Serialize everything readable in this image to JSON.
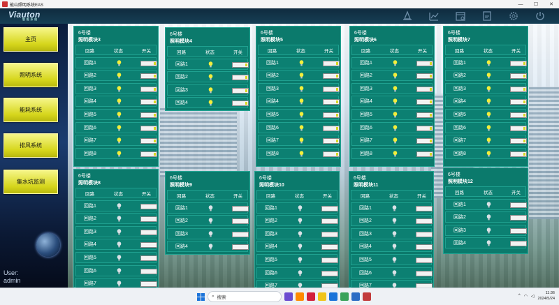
{
  "window": {
    "title": "能山照明系统EAS"
  },
  "logo": {
    "text": "Viauton",
    "sub": "智 能 系 统"
  },
  "toolbar": {
    "icons": [
      "bell-icon",
      "chart-icon",
      "calendar-icon",
      "document-icon",
      "settings-icon",
      "power-icon"
    ]
  },
  "sidebar": {
    "items": [
      {
        "label": "主页"
      },
      {
        "label": "照明系统"
      },
      {
        "label": "能耗系统"
      },
      {
        "label": "排风系统"
      },
      {
        "label": "集水坑监测"
      }
    ],
    "user_label": "User:",
    "user_name": "admin"
  },
  "table_headers": {
    "circuit": "回路",
    "status": "状态",
    "switch": "开关"
  },
  "panels": [
    {
      "building": "6号楼",
      "name": "照明模块3",
      "circuits": [
        {
          "label": "回路1",
          "lit": true
        },
        {
          "label": "回路2",
          "lit": true
        },
        {
          "label": "回路3",
          "lit": true
        },
        {
          "label": "回路4",
          "lit": true
        },
        {
          "label": "回路5",
          "lit": true
        },
        {
          "label": "回路6",
          "lit": true
        },
        {
          "label": "回路7",
          "lit": true
        },
        {
          "label": "回路8",
          "lit": true
        }
      ]
    },
    {
      "building": "6号楼",
      "name": "照明模块4",
      "circuits": [
        {
          "label": "回路1",
          "lit": true
        },
        {
          "label": "回路2",
          "lit": true
        },
        {
          "label": "回路3",
          "lit": true
        },
        {
          "label": "回路4",
          "lit": true
        }
      ]
    },
    {
      "building": "6号楼",
      "name": "照明模块5",
      "circuits": [
        {
          "label": "回路1",
          "lit": true
        },
        {
          "label": "回路2",
          "lit": true
        },
        {
          "label": "回路3",
          "lit": true
        },
        {
          "label": "回路4",
          "lit": true
        },
        {
          "label": "回路5",
          "lit": true
        },
        {
          "label": "回路6",
          "lit": true
        },
        {
          "label": "回路7",
          "lit": true
        },
        {
          "label": "回路8",
          "lit": true
        }
      ]
    },
    {
      "building": "6号楼",
      "name": "照明模块6",
      "circuits": [
        {
          "label": "回路1",
          "lit": true
        },
        {
          "label": "回路2",
          "lit": true
        },
        {
          "label": "回路3",
          "lit": true
        },
        {
          "label": "回路4",
          "lit": true
        },
        {
          "label": "回路5",
          "lit": true
        },
        {
          "label": "回路6",
          "lit": true
        },
        {
          "label": "回路7",
          "lit": true
        },
        {
          "label": "回路8",
          "lit": true
        }
      ]
    },
    {
      "building": "6号楼",
      "name": "照明模块7",
      "circuits": [
        {
          "label": "回路1",
          "lit": true
        },
        {
          "label": "回路2",
          "lit": true
        },
        {
          "label": "回路3",
          "lit": true
        },
        {
          "label": "回路4",
          "lit": true
        },
        {
          "label": "回路5",
          "lit": true
        },
        {
          "label": "回路6",
          "lit": true
        },
        {
          "label": "回路7",
          "lit": true
        },
        {
          "label": "回路8",
          "lit": true
        }
      ]
    },
    {
      "building": "6号楼",
      "name": "照明模块8",
      "circuits": [
        {
          "label": "回路1",
          "lit": false
        },
        {
          "label": "回路2",
          "lit": false
        },
        {
          "label": "回路3",
          "lit": false
        },
        {
          "label": "回路4",
          "lit": false
        },
        {
          "label": "回路5",
          "lit": false
        },
        {
          "label": "回路6",
          "lit": false
        },
        {
          "label": "回路7",
          "lit": false
        }
      ]
    },
    {
      "building": "6号楼",
      "name": "照明模块9",
      "circuits": [
        {
          "label": "回路1",
          "lit": false
        },
        {
          "label": "回路2",
          "lit": false
        },
        {
          "label": "回路3",
          "lit": false
        },
        {
          "label": "回路4",
          "lit": false
        }
      ]
    },
    {
      "building": "6号楼",
      "name": "照明模块10",
      "circuits": [
        {
          "label": "回路1",
          "lit": false
        },
        {
          "label": "回路2",
          "lit": false
        },
        {
          "label": "回路3",
          "lit": false
        },
        {
          "label": "回路4",
          "lit": false
        },
        {
          "label": "回路5",
          "lit": false
        },
        {
          "label": "回路6",
          "lit": false
        },
        {
          "label": "回路7",
          "lit": false
        }
      ]
    },
    {
      "building": "6号楼",
      "name": "照明模块11",
      "circuits": [
        {
          "label": "回路1",
          "lit": false
        },
        {
          "label": "回路2",
          "lit": false
        },
        {
          "label": "回路3",
          "lit": false
        },
        {
          "label": "回路4",
          "lit": false
        },
        {
          "label": "回路5",
          "lit": false
        },
        {
          "label": "回路6",
          "lit": false
        },
        {
          "label": "回路7",
          "lit": false
        }
      ]
    },
    {
      "building": "6号楼",
      "name": "照明模块12",
      "circuits": [
        {
          "label": "回路1",
          "lit": false
        },
        {
          "label": "回路2",
          "lit": false
        },
        {
          "label": "回路3",
          "lit": false
        },
        {
          "label": "回路4",
          "lit": false
        }
      ]
    }
  ],
  "taskbar": {
    "search_placeholder": "搜索",
    "time": "11:36",
    "date": "2024/5/24"
  },
  "colors": {
    "panel": "#0b7a6c",
    "bulb_on": "#f2ee3c",
    "bulb_off": "#d9e2e6",
    "nav": "#e7e740"
  }
}
